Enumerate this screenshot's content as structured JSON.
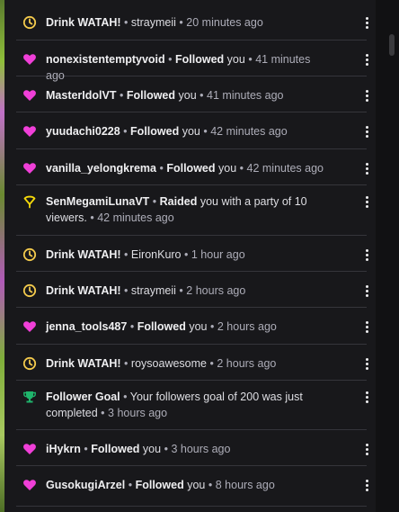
{
  "colors": {
    "background": "#18181b",
    "divider": "#35353b",
    "timer_icon": "#f2c94c",
    "heart_icon": "#f03fd8",
    "raid_icon": "#f5d90a",
    "trophy_icon": "#1fb56c"
  },
  "separator": "•",
  "feed": {
    "items": [
      {
        "icon": "timer-icon",
        "name": "Drink WATAH!",
        "parts": [
          {
            "t": "straymeii",
            "b": false
          }
        ],
        "time": "20 minutes ago"
      },
      {
        "icon": "heart-icon",
        "name": "nonexistentemptyvoid",
        "parts": [
          {
            "t": "Followed",
            "b": true
          },
          {
            "t": " you",
            "b": false
          }
        ],
        "time": "41 minutes ago"
      },
      {
        "icon": "heart-icon",
        "name": "MasterIdolVT",
        "parts": [
          {
            "t": "Followed",
            "b": true
          },
          {
            "t": " you",
            "b": false
          }
        ],
        "time": "41 minutes ago"
      },
      {
        "icon": "heart-icon",
        "name": "yuudachi0228",
        "parts": [
          {
            "t": "Followed",
            "b": true
          },
          {
            "t": " you",
            "b": false
          }
        ],
        "time": "42 minutes ago"
      },
      {
        "icon": "heart-icon",
        "name": "vanilla_yelongkrema",
        "parts": [
          {
            "t": "Followed",
            "b": true
          },
          {
            "t": " you",
            "b": false
          }
        ],
        "time": "42 minutes ago"
      },
      {
        "icon": "raid-icon",
        "name": "SenMegamiLunaVT",
        "parts": [
          {
            "t": "Raided",
            "b": true
          },
          {
            "t": " you with a party of 10 viewers.",
            "b": false
          }
        ],
        "time": "42 minutes ago"
      },
      {
        "icon": "timer-icon",
        "name": "Drink WATAH!",
        "parts": [
          {
            "t": "EironKuro",
            "b": false
          }
        ],
        "time": "1 hour ago"
      },
      {
        "icon": "timer-icon",
        "name": "Drink WATAH!",
        "parts": [
          {
            "t": "straymeii",
            "b": false
          }
        ],
        "time": "2 hours ago"
      },
      {
        "icon": "heart-icon",
        "name": "jenna_tools487",
        "parts": [
          {
            "t": "Followed",
            "b": true
          },
          {
            "t": " you",
            "b": false
          }
        ],
        "time": "2 hours ago"
      },
      {
        "icon": "timer-icon",
        "name": "Drink WATAH!",
        "parts": [
          {
            "t": "roysoawesome",
            "b": false
          }
        ],
        "time": "2 hours ago"
      },
      {
        "icon": "trophy-icon",
        "name": "Follower Goal",
        "parts": [
          {
            "t": "Your followers goal of 200 was just completed",
            "b": false
          }
        ],
        "time": "3 hours ago"
      },
      {
        "icon": "heart-icon",
        "name": "iHykrn",
        "parts": [
          {
            "t": "Followed",
            "b": true
          },
          {
            "t": " you",
            "b": false
          }
        ],
        "time": "3 hours ago"
      },
      {
        "icon": "heart-icon",
        "name": "GusokugiArzel",
        "parts": [
          {
            "t": "Followed",
            "b": true
          },
          {
            "t": " you",
            "b": false
          }
        ],
        "time": "8 hours ago"
      }
    ]
  }
}
